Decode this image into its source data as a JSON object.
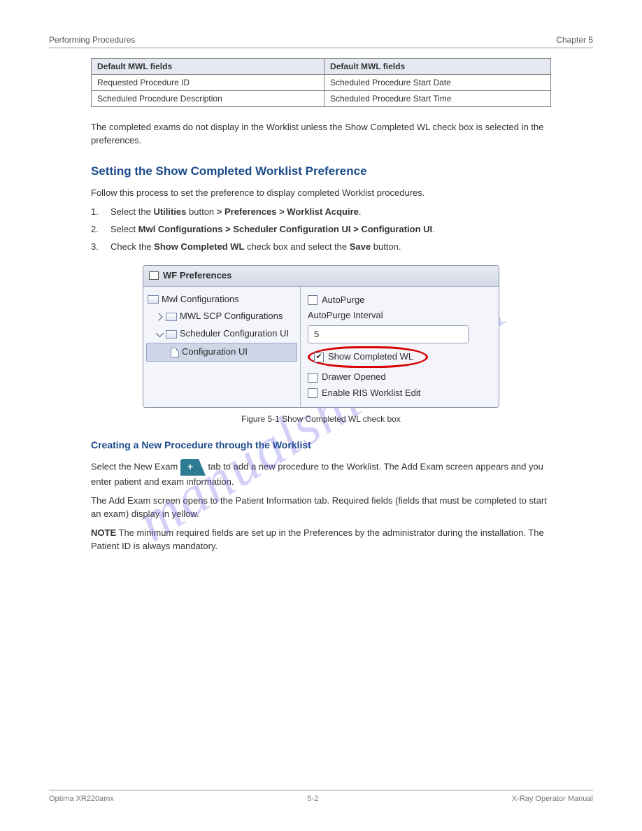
{
  "header": {
    "left": "Performing Procedures",
    "right": "Chapter 5"
  },
  "table": {
    "headers": [
      "Default MWL fields",
      "Default MWL fields"
    ],
    "rows": [
      [
        "Requested Procedure ID",
        "Scheduled Procedure Start Date"
      ],
      [
        "Scheduled Procedure Description",
        "Scheduled Procedure Start Time"
      ]
    ]
  },
  "section": {
    "p1": "The completed exams do not display in the Worklist unless the Show Completed WL check box is selected in the preferences.",
    "h1": "Setting the Show Completed Worklist Preference",
    "p2": "Follow this process to set the preference to display completed Worklist procedures.",
    "steps": [
      {
        "num": "1.",
        "text_a": "Select the ",
        "bold_a": "Utilities",
        "text_b": " button ",
        "bold_b": ">",
        "text_c": " ",
        "bold_c": "Preferences",
        "text_d": " ",
        "bold_d": ">",
        "text_e": " ",
        "bold_e": "Worklist Acquire",
        "text_f": "."
      },
      {
        "num": "2.",
        "text_a": "Select ",
        "bold_a": "Mwl Configurations",
        "text_b": " ",
        "bold_b": ">",
        "text_c": " ",
        "bold_c": "Scheduler Configuration UI",
        "text_d": " ",
        "bold_d": ">",
        "text_e": " ",
        "bold_e": "Configuration UI",
        "text_f": "."
      },
      {
        "num": "3.",
        "text_a": "Check the ",
        "bold_a": "Show Completed WL",
        "text_b": " check box and select the ",
        "bold_b": "Save",
        "text_c": " button."
      }
    ],
    "figure": {
      "window_title": "WF Preferences",
      "tree": {
        "root": "Mwl Configurations",
        "child1": "MWL SCP Configurations",
        "child2": "Scheduler Configuration UI",
        "leaf": "Configuration UI"
      },
      "form": {
        "autopurge": "AutoPurge",
        "interval_label": "AutoPurge Interval",
        "interval_value": "5",
        "show_completed": "Show Completed WL",
        "drawer_opened": "Drawer Opened",
        "enable_ris": "Enable RIS Worklist Edit"
      },
      "caption": "Figure 5-1 Show Completed WL check box"
    },
    "h2": "Creating a New Procedure through the Worklist",
    "p3_a": "Select the New Exam ",
    "p3_b": " tab to add a new procedure to the Worklist. The Add Exam screen appears and you enter patient and exam information.",
    "p4": "The Add Exam screen opens to the Patient Information tab. Required fields (fields that must be completed to start an exam) display in yellow.",
    "note_title": "NOTE",
    "note_body": "The minimum required fields are set up in the Preferences by the administrator during the installation. The Patient ID is always mandatory."
  },
  "footer": {
    "left": "Optima XR220amx",
    "center": "5-2",
    "right": "X-Ray Operator Manual"
  },
  "watermark": "manualshive.com"
}
